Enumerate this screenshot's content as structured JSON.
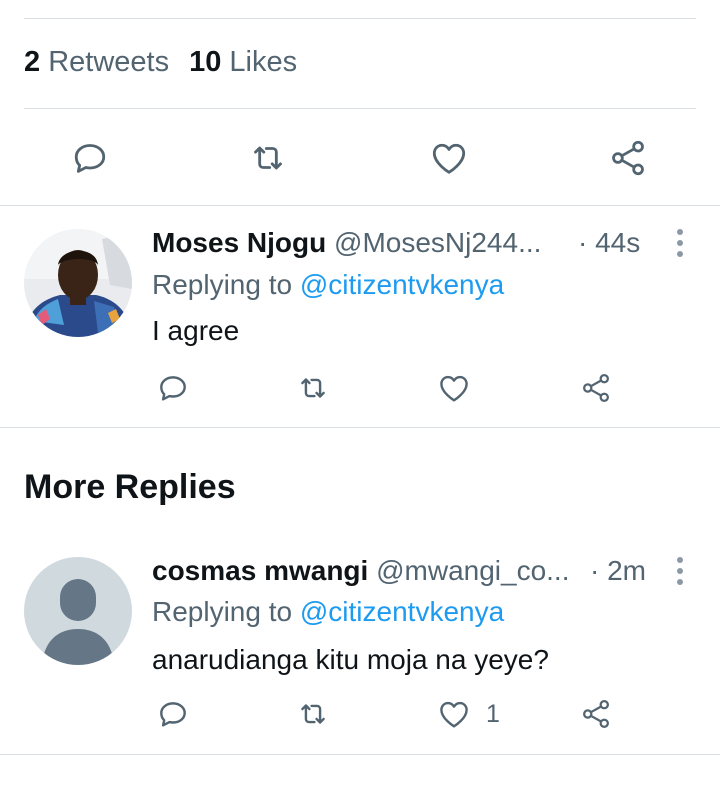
{
  "stats": {
    "retweets_count": "2",
    "retweets_label": "Retweets",
    "likes_count": "10",
    "likes_label": "Likes"
  },
  "main_actions": {
    "reply_icon": "reply-icon",
    "retweet_icon": "retweet-icon",
    "like_icon": "like-icon",
    "share_icon": "share-icon"
  },
  "replies": [
    {
      "name": "Moses Njogu",
      "handle": "@MosesNj244...",
      "time": "· 44s",
      "replying_prefix": "Replying to",
      "replying_to": "@citizentvkenya",
      "text": "I agree",
      "like_count": ""
    },
    {
      "name": "cosmas mwangi",
      "handle": "@mwangi_co...",
      "time": "· 2m",
      "replying_prefix": "Replying to",
      "replying_to": "@citizentvkenya",
      "text": "anarudianga kitu moja na yeye?",
      "like_count": "1"
    }
  ],
  "more_replies": {
    "title": "More Replies"
  },
  "colors": {
    "text": "#0f1419",
    "secondary": "#536471",
    "link": "#1d9bf0",
    "divider": "#d9dfe3",
    "avatar_placeholder_bg": "#cfd9de",
    "avatar_placeholder_fg": "#657786"
  }
}
